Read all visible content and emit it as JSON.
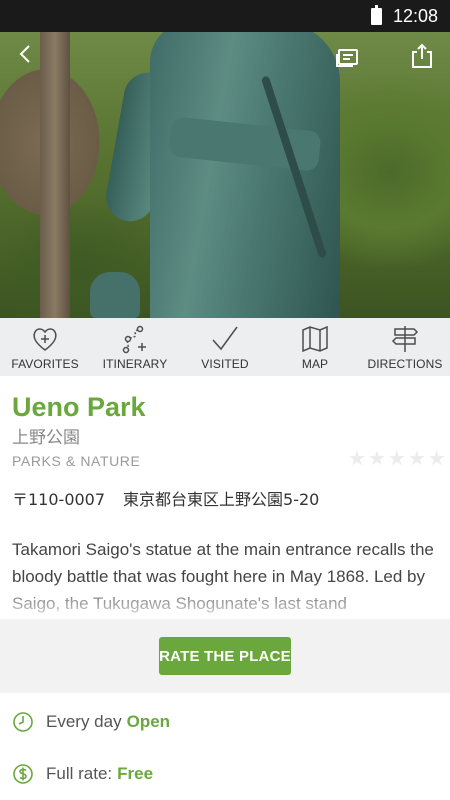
{
  "status_bar": {
    "time": "12:08"
  },
  "hero": {
    "image_alt": "Statue of Takamori Saigo at Ueno Park"
  },
  "actions": [
    {
      "label": "FAVORITES",
      "icon": "heart-plus-icon"
    },
    {
      "label": "ITINERARY",
      "icon": "route-plus-icon"
    },
    {
      "label": "VISITED",
      "icon": "checkmark-icon"
    },
    {
      "label": "MAP",
      "icon": "map-icon"
    },
    {
      "label": "DIRECTIONS",
      "icon": "signpost-icon"
    }
  ],
  "place": {
    "name": "Ueno Park",
    "name_jp": "上野公園",
    "category": "PARKS & NATURE",
    "rating": 0,
    "rating_max": 5,
    "postal_code": "〒110-0007",
    "address": "東京都台東区上野公園5-20",
    "description": "Takamori Saigo's statue at the main entrance recalls the bloody battle that was fought here in May 1868. Led by Saigo, the Tukugawa Shogunate's last stand"
  },
  "rate_button": {
    "label": "RATE THE PLACE"
  },
  "hours": {
    "label": "Every day",
    "status": "Open"
  },
  "admission": {
    "label": "Full rate:",
    "value": "Free"
  },
  "colors": {
    "accent": "#6aa83e",
    "action_bar": "#eceef0"
  }
}
